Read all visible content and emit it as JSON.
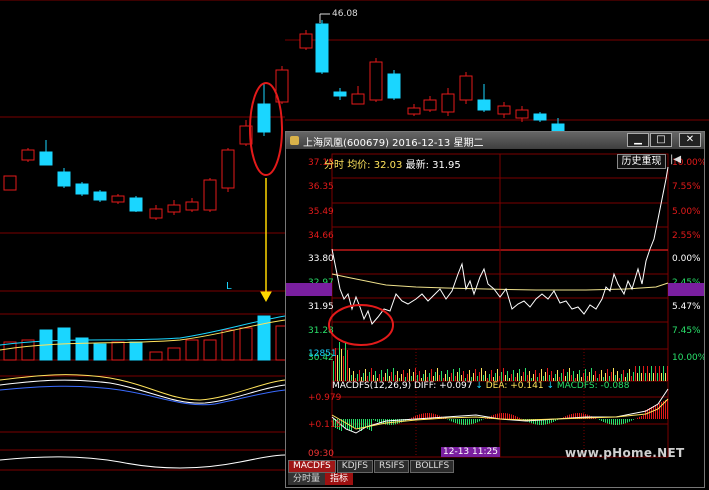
{
  "background": {
    "high_label": "46.08",
    "l_mark": "L"
  },
  "window": {
    "title": "上海凤凰(600679) 2016-12-13 星期二",
    "buttons": {
      "minimize": "▁",
      "maximize": "□",
      "close": "✕"
    },
    "info": {
      "ma_label": "分时",
      "avg_label": "均价:",
      "avg_value": "32.03",
      "last_label": "最新:",
      "last_value": "31.95"
    },
    "history_button": "历史重现",
    "history_arrow": "|◀",
    "price_axis": [
      "37.18",
      "36.35",
      "35.49",
      "34.66",
      "33.80",
      "32.97",
      "31.95",
      "31.28",
      "30.42"
    ],
    "pct_axis": [
      "10.00%",
      "7.55%",
      "5.00%",
      "2.55%",
      "0.00%",
      "2.45%",
      "5.47%",
      "7.45%",
      "10.00%"
    ],
    "volume_label": "12851",
    "macd": {
      "title": "MACDFS(12,26,9)",
      "diff_label": "DIFF:",
      "diff_value": "+0.097",
      "dea_label": "DEA:",
      "dea_value": "+0.141",
      "macdfs_label": "MACDFS:",
      "macdfs_value": "-0.088",
      "axis_top": "+0.979",
      "axis_mid": "+0.115"
    },
    "time_start": "09:30",
    "time_cursor": "12-13 11:25",
    "indicator_tabs": [
      "MACDFS",
      "KDJFS",
      "RSIFS",
      "BOLLFS"
    ],
    "bottom_tabs": [
      "分时量",
      "指标"
    ],
    "colors": {
      "up": "#e31a1a",
      "down": "#1ad6ff",
      "price_line": "#ffffff",
      "avg_line": "#f0e28c",
      "highlight": "#7a1fa0"
    }
  },
  "watermark": "www.pHome.NET"
}
